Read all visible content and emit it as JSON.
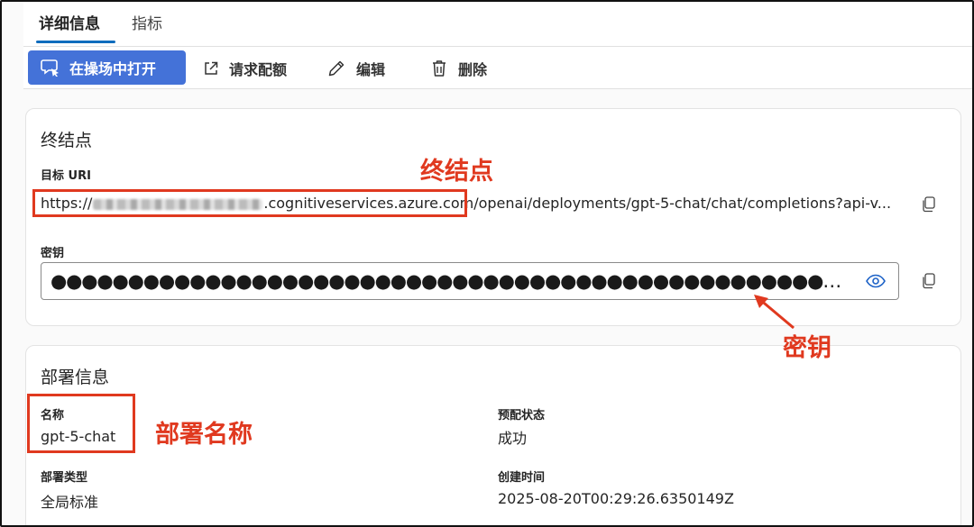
{
  "tabs": [
    {
      "label": "详细信息",
      "active": true
    },
    {
      "label": "指标",
      "active": false
    }
  ],
  "toolbar": {
    "open_playground": "在操场中打开",
    "request_quota": "请求配额",
    "edit": "编辑",
    "delete": "删除"
  },
  "endpoint": {
    "title": "终结点",
    "target_uri_label": "目标 URI",
    "uri_prefix": "https://",
    "uri_suffix": ".cognitiveservices.azure.com/openai/deployments/gpt-5-chat/chat/completions?api-v...",
    "key_label": "密钥",
    "key_value": "●●●●●●●●●●●●●●●●●●●●●●●●●●●●●●●●●●●●●●●●●●●●●●●●●●●●●●●●●●●●●●●●●●●●●●●●●●●●●●●●●●●●●●●●●●●●●●●●●●●●●●●●…"
  },
  "deployment": {
    "title": "部署信息",
    "name_label": "名称",
    "name_value": "gpt-5-chat",
    "provisioning_label": "预配状态",
    "provisioning_value": "成功",
    "type_label": "部署类型",
    "type_value": "全局标准",
    "created_label": "创建时间",
    "created_value": "2025-08-20T00:29:26.6350149Z"
  },
  "annotations": {
    "endpoint": "终结点",
    "key": "密钥",
    "deployment_name": "部署名称"
  },
  "colors": {
    "primary": "#4472d8",
    "accent": "#0f6cbd",
    "annotation": "#e0391f"
  }
}
